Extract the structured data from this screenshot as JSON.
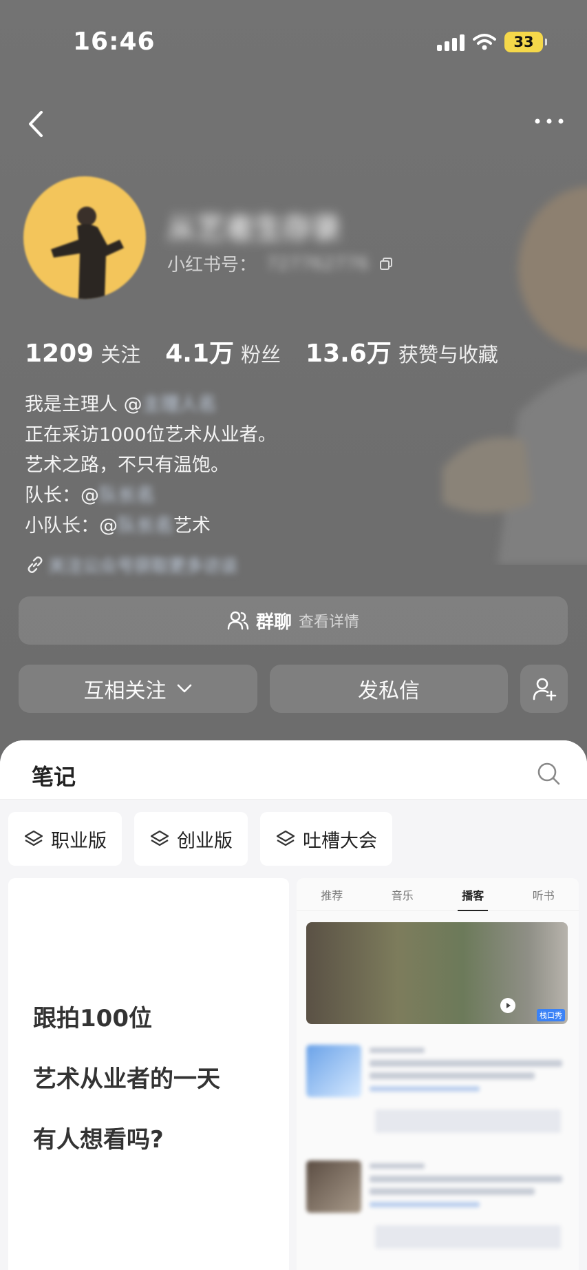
{
  "status_bar": {
    "time": "16:46",
    "battery": "33"
  },
  "profile": {
    "name": "从艺者生存录",
    "id_label": "小红书号：",
    "id_value": "727762776",
    "stats": [
      {
        "value": "1209",
        "label": "关注"
      },
      {
        "value": "4.1万",
        "label": "粉丝"
      },
      {
        "value": "13.6万",
        "label": "获赞与收藏"
      }
    ],
    "bio": {
      "line1_prefix": "我是主理人 @",
      "line1_mention": "主理人名",
      "line2": "正在采访1000位艺术从业者。",
      "line3": "艺术之路，不只有温饱。",
      "line4_prefix": "队长：@",
      "line4_mention": "队长名",
      "line5_prefix": "小队长：@",
      "line5_mention": "队长名",
      "line5_suffix": "艺术"
    },
    "link_text": "关注公众号获取更多访谈"
  },
  "group_chat": {
    "label": "群聊",
    "sub": "查看详情"
  },
  "actions": {
    "follow": "互相关注",
    "message": "发私信"
  },
  "sheet": {
    "title": "笔记",
    "chips": [
      {
        "label": "职业版"
      },
      {
        "label": "创业版"
      },
      {
        "label": "吐槽大会"
      }
    ]
  },
  "note_left": {
    "line1": "跟拍100位",
    "line2": "艺术从业者的一天",
    "line3": "有人想看吗?"
  },
  "note_right": {
    "tabs": [
      "推荐",
      "音乐",
      "播客",
      "听书"
    ],
    "active_tab": "播客",
    "badge": "栈口秀"
  }
}
